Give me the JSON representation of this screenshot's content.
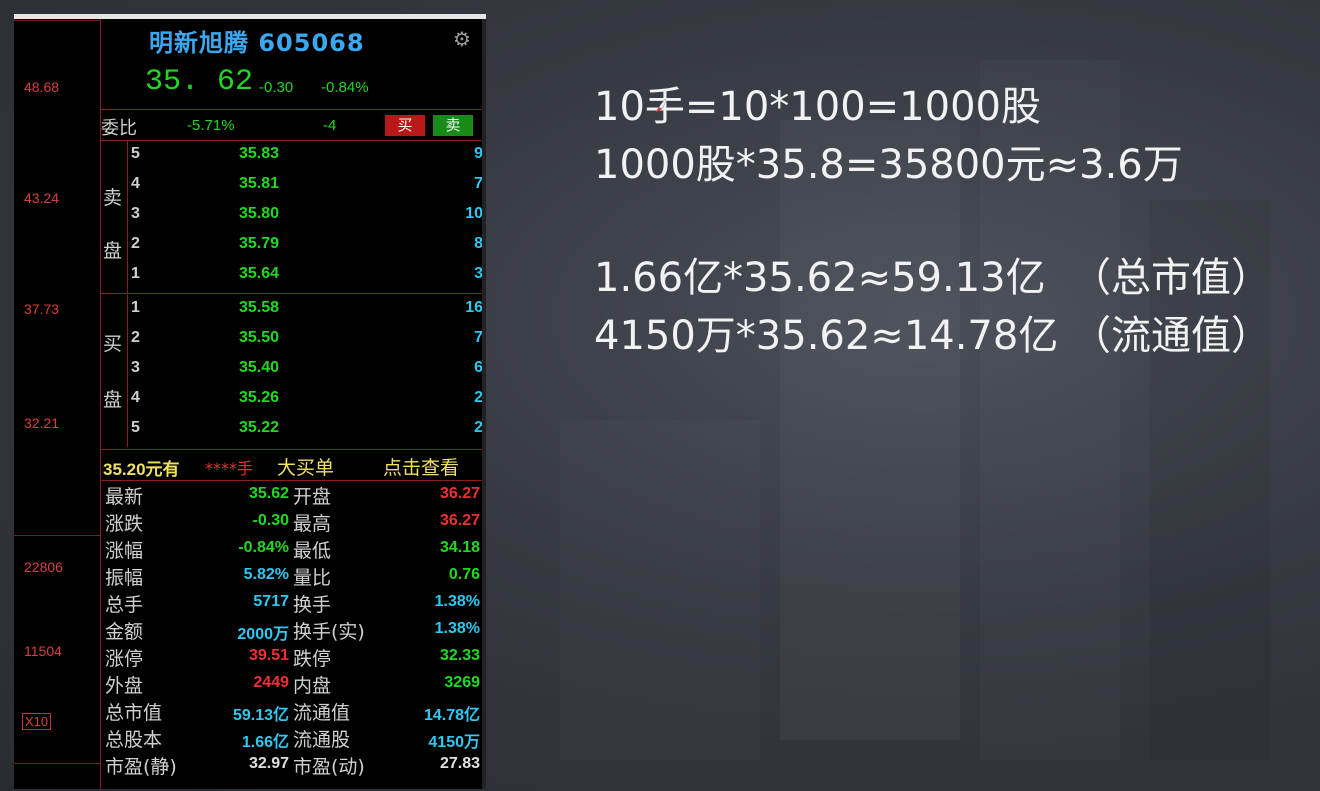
{
  "stock": {
    "title": "明新旭腾 605068",
    "price": "35. 62",
    "change": "-0.30",
    "change_pct": "-0.84%"
  },
  "axis_labels": [
    "48.68",
    "43.24",
    "37.73",
    "32.21",
    "22806",
    "11504",
    "X10"
  ],
  "order_ratio": {
    "label": "委比",
    "ratio": "-5.71%",
    "diff": "-4",
    "buy_label": "买",
    "sell_label": "卖"
  },
  "sell_side_label": [
    "卖",
    "盘"
  ],
  "buy_side_label": [
    "买",
    "盘"
  ],
  "sell_levels": [
    {
      "n": "5",
      "price": "35.83",
      "vol": "9"
    },
    {
      "n": "4",
      "price": "35.81",
      "vol": "7"
    },
    {
      "n": "3",
      "price": "35.80",
      "vol": "10"
    },
    {
      "n": "2",
      "price": "35.79",
      "vol": "8"
    },
    {
      "n": "1",
      "price": "35.64",
      "vol": "3"
    }
  ],
  "buy_levels": [
    {
      "n": "1",
      "price": "35.58",
      "vol": "16"
    },
    {
      "n": "2",
      "price": "35.50",
      "vol": "7"
    },
    {
      "n": "3",
      "price": "35.40",
      "vol": "6"
    },
    {
      "n": "4",
      "price": "35.26",
      "vol": "2"
    },
    {
      "n": "5",
      "price": "35.22",
      "vol": "2"
    }
  ],
  "big_order": {
    "price_text": "35.20元有",
    "stars": "****手",
    "label": "大买单",
    "link": "点击查看"
  },
  "stats": [
    {
      "k1": "最新",
      "v1": "35.62",
      "c1": "green",
      "k2": "开盘",
      "v2": "36.27",
      "c2": "red"
    },
    {
      "k1": "涨跌",
      "v1": "-0.30",
      "c1": "green",
      "k2": "最高",
      "v2": "36.27",
      "c2": "red"
    },
    {
      "k1": "涨幅",
      "v1": "-0.84%",
      "c1": "green",
      "k2": "最低",
      "v2": "34.18",
      "c2": "green"
    },
    {
      "k1": "振幅",
      "v1": "5.82%",
      "c1": "cyan",
      "k2": "量比",
      "v2": "0.76",
      "c2": "green"
    },
    {
      "k1": "总手",
      "v1": "5717",
      "c1": "cyan",
      "k2": "换手",
      "v2": "1.38%",
      "c2": "cyan"
    },
    {
      "k1": "金额",
      "v1": "2000万",
      "c1": "cyan",
      "k2": "换手(实)",
      "v2": "1.38%",
      "c2": "cyan"
    },
    {
      "k1": "涨停",
      "v1": "39.51",
      "c1": "red",
      "k2": "跌停",
      "v2": "32.33",
      "c2": "green"
    },
    {
      "k1": "外盘",
      "v1": "2449",
      "c1": "red",
      "k2": "内盘",
      "v2": "3269",
      "c2": "green"
    },
    {
      "k1": "总市值",
      "v1": "59.13亿",
      "c1": "cyan",
      "k2": "流通值",
      "v2": "14.78亿",
      "c2": "cyan"
    },
    {
      "k1": "总股本",
      "v1": "1.66亿",
      "c1": "cyan",
      "k2": "流通股",
      "v2": "4150万",
      "c2": "cyan"
    },
    {
      "k1": "市盈(静)",
      "v1": "32.97",
      "c1": "white",
      "k2": "市盈(动)",
      "v2": "27.83",
      "c2": "white"
    }
  ],
  "notes": [
    "10手=10*100=1000股",
    "1000股*35.8=35800元≈3.6万",
    "",
    "1.66亿*35.62≈59.13亿  （总市值）",
    "4150万*35.62≈14.78亿 （流通值）"
  ],
  "colors": {
    "up": "#f03030",
    "down": "#20d820",
    "volume": "#2ec8f0",
    "title": "#3aa8f0",
    "grid": "#8a1e1e"
  },
  "icons": {
    "settings": "gear-icon"
  }
}
